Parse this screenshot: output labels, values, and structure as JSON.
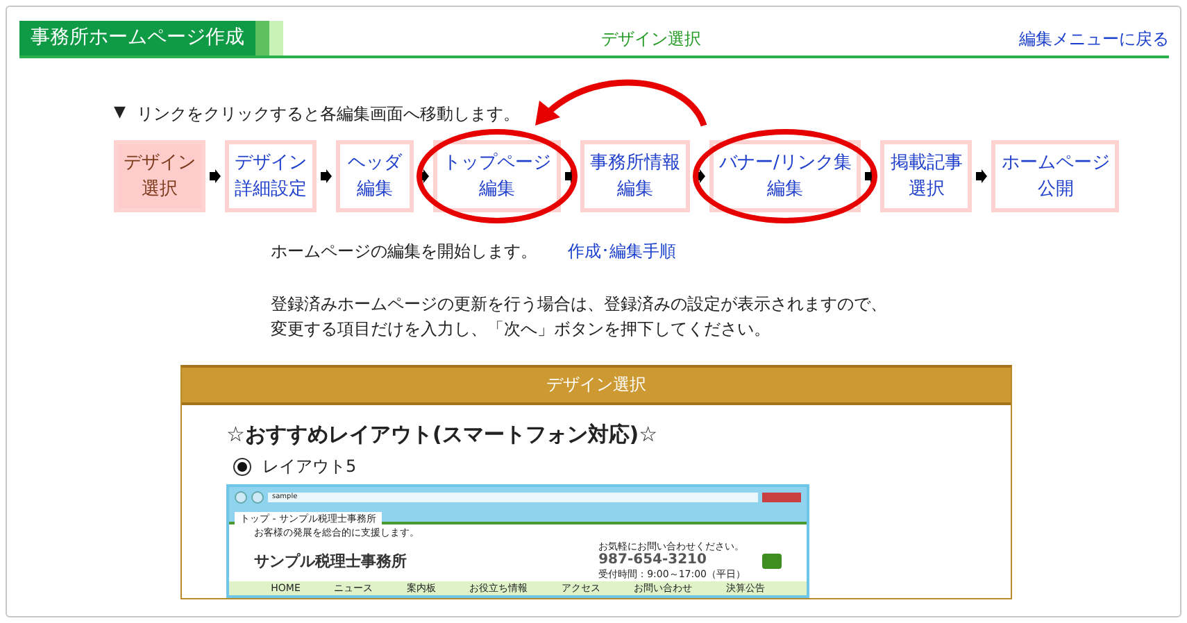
{
  "header": {
    "title": "事務所ホームページ作成",
    "page_title": "デザイン選択",
    "back_link": "編集メニューに戻る"
  },
  "instruction": {
    "marker": "▼",
    "text": "リンクをクリックすると各編集画面へ移動します。"
  },
  "steps": [
    {
      "lines": [
        "デザイン",
        "選択"
      ],
      "selected": true,
      "circled": false
    },
    {
      "lines": [
        "デザイン",
        "詳細設定"
      ],
      "selected": false,
      "circled": false
    },
    {
      "lines": [
        "ヘッダ",
        "編集"
      ],
      "selected": false,
      "circled": false
    },
    {
      "lines": [
        "トップページ",
        "編集"
      ],
      "selected": false,
      "circled": true
    },
    {
      "lines": [
        "事務所情報",
        "編集"
      ],
      "selected": false,
      "circled": false
    },
    {
      "lines": [
        "バナー/リンク集",
        "編集"
      ],
      "selected": false,
      "circled": true
    },
    {
      "lines": [
        "掲載記事",
        "選択"
      ],
      "selected": false,
      "circled": false
    },
    {
      "lines": [
        "ホームページ",
        "公開"
      ],
      "selected": false,
      "circled": false
    }
  ],
  "intro": {
    "text": "ホームページの編集を開始します。",
    "link": "作成･編集手順"
  },
  "note_lines": [
    "登録済みホームページの更新を行う場合は、登録済みの設定が表示されますので、",
    "変更する項目だけを入力し、「次へ」ボタンを押下してください。"
  ],
  "panel": {
    "title": "デザイン選択",
    "heading": "☆おすすめレイアウト(スマートフォン対応)☆",
    "layouts": [
      {
        "label": "レイアウト5",
        "selected": true
      }
    ],
    "preview": {
      "address": "sample",
      "tab": "トップ - サンプル税理士事務所",
      "tagline": "お客様の発展を総合的に支援します。",
      "site_name": "サンプル税理士事務所",
      "contact_note": "お気軽にお問い合わせください。",
      "phone": "987-654-3210",
      "hours": "受付時間：9:00～17:00（平日）",
      "nav": [
        "HOME",
        "ニュース",
        "案内板",
        "お役立ち情報",
        "アクセス",
        "お問い合わせ",
        "決算公告"
      ]
    }
  }
}
